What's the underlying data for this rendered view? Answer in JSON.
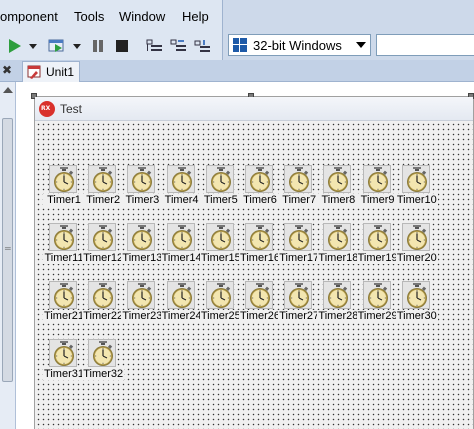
{
  "menu": [
    "omponent",
    "Tools",
    "Window",
    "Help"
  ],
  "platform": {
    "selected": "32-bit Windows"
  },
  "tab": {
    "label": "Unit1"
  },
  "form": {
    "caption": "Test",
    "icon_text": "RX",
    "timers": [
      "Timer1",
      "Timer2",
      "Timer3",
      "Timer4",
      "Timer5",
      "Timer6",
      "Timer7",
      "Timer8",
      "Timer9",
      "Timer10",
      "Timer11",
      "Timer12",
      "Timer13",
      "Timer14",
      "Timer15",
      "Timer16",
      "Timer17",
      "Timer18",
      "Timer19",
      "Timer20",
      "Timer21",
      "Timer22",
      "Timer23",
      "Timer24",
      "Timer25",
      "Timer26",
      "Timer27",
      "Timer28",
      "Timer29",
      "Timer30",
      "Timer31",
      "Timer32"
    ]
  },
  "icons": {
    "toolbar": [
      "run-icon",
      "run-dropdown-icon",
      "run-without-debug-icon",
      "run-without-debug-dropdown-icon",
      "pause-icon",
      "stop-icon",
      "step-into-icon",
      "step-over-icon",
      "run-to-cursor-icon"
    ],
    "timer": "stopwatch-icon",
    "tab": "form-unit-icon",
    "form": "app-icon"
  },
  "colors": {
    "menubar": "#dde6f2",
    "designer": "#ffffff",
    "form": "#f0f0f0",
    "form_icon": "#d9312b",
    "run_green": "#2e9e3e"
  }
}
